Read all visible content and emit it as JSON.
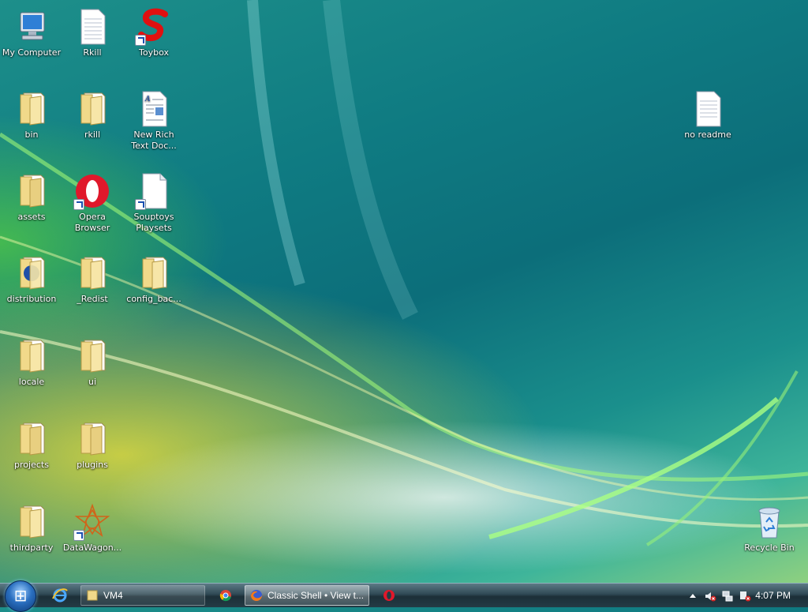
{
  "desktop": {
    "icons": [
      {
        "label": "My Computer"
      },
      {
        "label": "Rkill"
      },
      {
        "label": "Toybox"
      },
      {
        "label": "bin"
      },
      {
        "label": "rkill"
      },
      {
        "label": "New Rich Text Doc..."
      },
      {
        "label": "assets"
      },
      {
        "label": "Opera Browser"
      },
      {
        "label": "Souptoys Playsets"
      },
      {
        "label": "distribution"
      },
      {
        "label": "_Redist"
      },
      {
        "label": "config_bac..."
      },
      {
        "label": "locale"
      },
      {
        "label": "ui"
      },
      {
        "label": "projects"
      },
      {
        "label": "plugins"
      },
      {
        "label": "thirdparty"
      },
      {
        "label": "DataWagon..."
      },
      {
        "label": "no readme"
      },
      {
        "label": "Recycle Bin"
      }
    ]
  },
  "taskbar": {
    "start_icon": "windows-orb-icon",
    "quicklaunch": [
      "internet-explorer-icon"
    ],
    "buttons": [
      {
        "label": "VM4",
        "icon": "folder-icon"
      },
      {
        "label": "",
        "icon": "chrome-icon"
      },
      {
        "label": "Classic Shell • View t...",
        "icon": "firefox-icon"
      },
      {
        "label": "",
        "icon": "opera-icon"
      }
    ],
    "tray": {
      "icons": [
        "show-hidden-icons-arrow",
        "volume-muted-icon",
        "network-icon",
        "action-center-icon"
      ],
      "clock": "4:07 PM"
    }
  },
  "colors": {
    "folder": "#f1d98a",
    "taskbar": "#2f4954"
  }
}
